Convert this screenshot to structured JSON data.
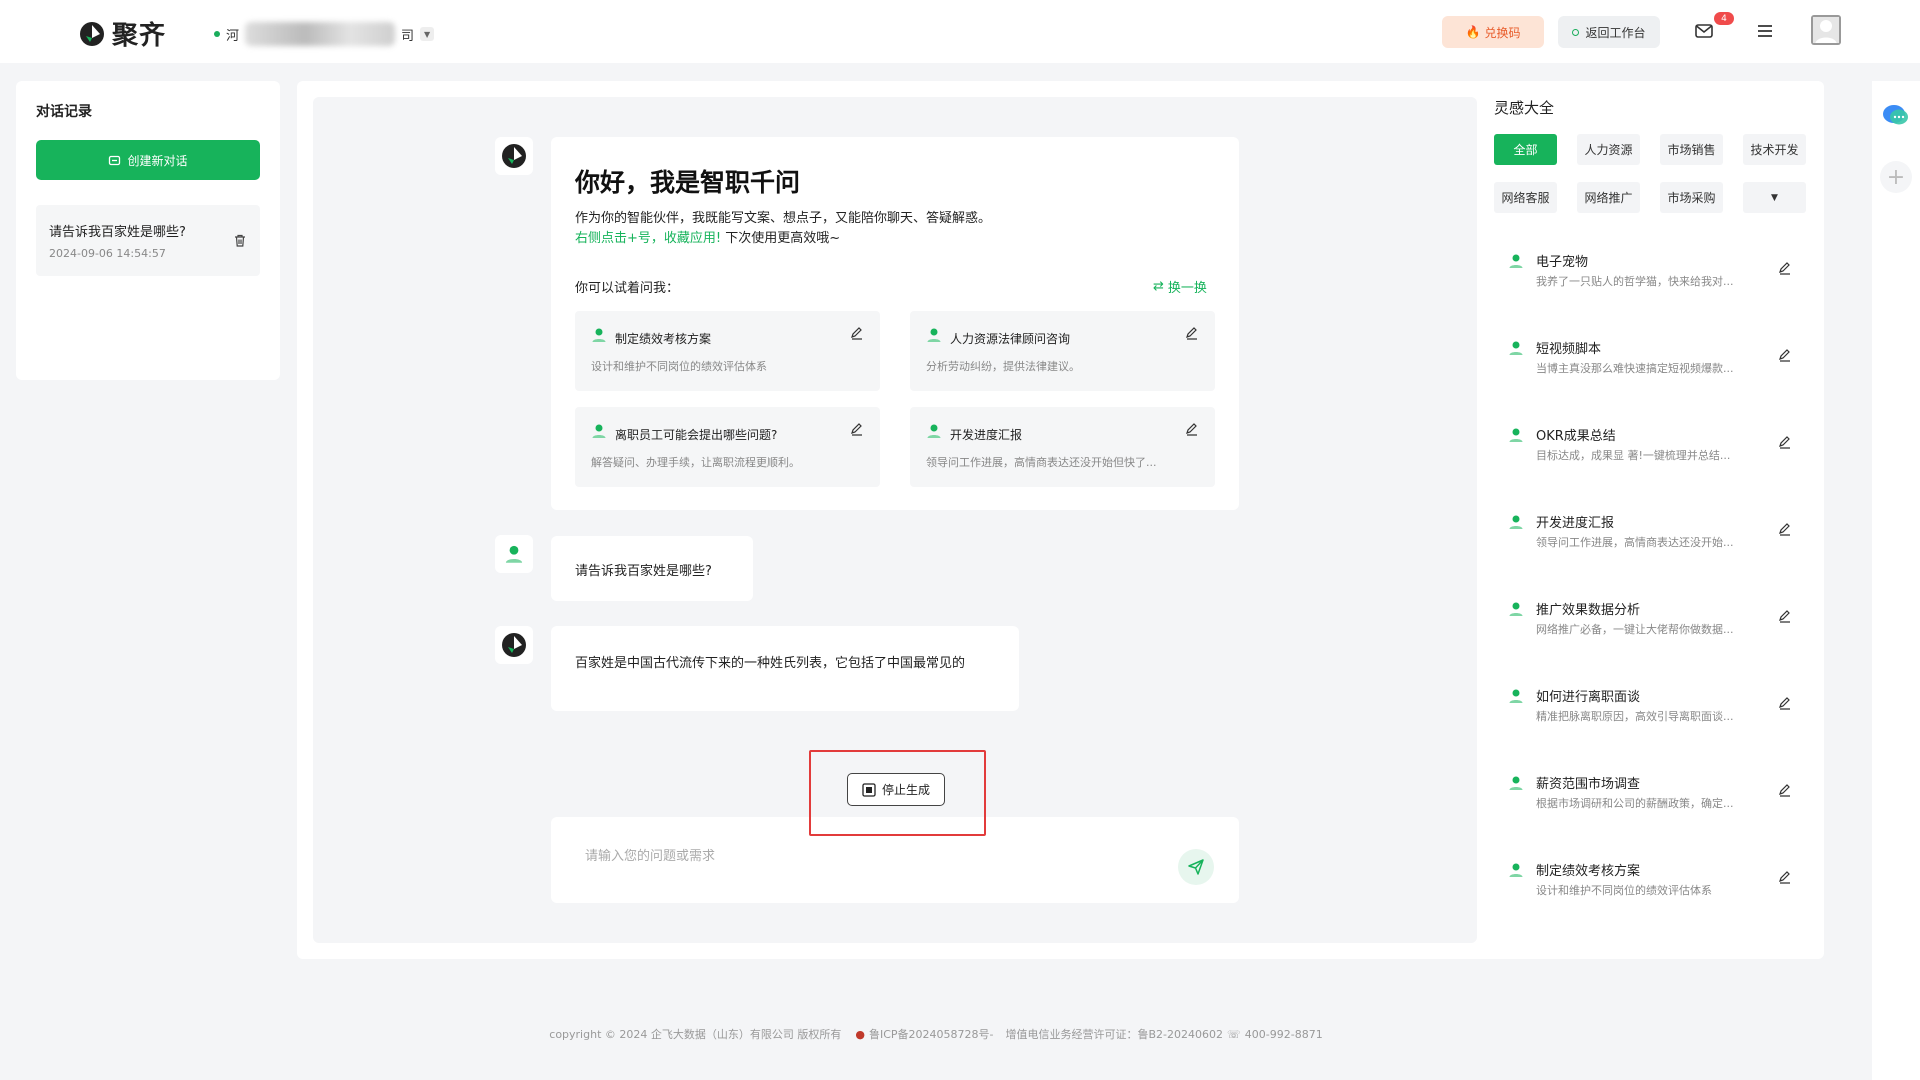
{
  "header": {
    "logo_text": "聚齐",
    "org_prefix": "河",
    "org_suffix": "司",
    "redeem_label": "兑换码",
    "back_label": "返回工作台",
    "mail_badge": "4"
  },
  "sidebar": {
    "title": "对话记录",
    "new_chat_label": "创建新对话",
    "history": [
      {
        "question": "请告诉我百家姓是哪些?",
        "time": "2024-09-06 14:54:57"
      }
    ]
  },
  "welcome": {
    "heading": "你好，我是智职千问",
    "intro": "作为你的智能伙伴，我既能写文案、想点子，又能陪你聊天、答疑解惑。",
    "tip_green": "右侧点击+号，收藏应用!",
    "tip_rest": " 下次使用更高效哦~",
    "try_label": "你可以试着问我：",
    "swap_label": "换一换",
    "cards": [
      {
        "title": "制定绩效考核方案",
        "desc": "设计和维护不同岗位的绩效评估体系"
      },
      {
        "title": "人力资源法律顾问咨询",
        "desc": "分析劳动纠纷，提供法律建议。"
      },
      {
        "title": "离职员工可能会提出哪些问题?",
        "desc": "解答疑问、办理手续，让离职流程更顺利。"
      },
      {
        "title": "开发进度汇报",
        "desc": "领导问工作进展，高情商表达还没开始但快了..."
      }
    ]
  },
  "conversation": {
    "user_message": "请告诉我百家姓是哪些?",
    "bot_message": "百家姓是中国古代流传下来的一种姓氏列表，它包括了中国最常见的"
  },
  "stop_label": "停止生成",
  "input": {
    "placeholder": "请输入您的问题或需求",
    "value": ""
  },
  "inspiration": {
    "title": "灵感大全",
    "tags": [
      "全部",
      "人力资源",
      "市场销售",
      "技术开发",
      "网络客服",
      "网络推广",
      "市场采购"
    ],
    "items": [
      {
        "title": "电子宠物",
        "desc": "我养了一只贴人的哲学猫，快来给我对..."
      },
      {
        "title": "短视频脚本",
        "desc": "当博主真没那么难快速搞定短视频爆款..."
      },
      {
        "title": "OKR成果总结",
        "desc": "目标达成，成果显 著!一键梳理并总结..."
      },
      {
        "title": "开发进度汇报",
        "desc": "领导问工作进展，高情商表达还没开始..."
      },
      {
        "title": "推广效果数据分析",
        "desc": "网络推广必备，一键让大佬帮你做数据..."
      },
      {
        "title": "如何进行离职面谈",
        "desc": "精准把脉离职原因，高效引导离职面谈..."
      },
      {
        "title": "薪资范围市场调查",
        "desc": "根据市场调研和公司的薪酬政策，确定..."
      },
      {
        "title": "制定绩效考核方案",
        "desc": "设计和维护不同岗位的绩效评估体系"
      }
    ]
  },
  "footer": {
    "copyright": "copyright © 2024 企飞大数据（山东）有限公司 版权所有",
    "icp": "鲁ICP备2024058728号-",
    "license": "增值电信业务经营许可证：鲁B2-20240602",
    "phone": "400-992-8871"
  },
  "colors": {
    "brand": "#17b35b",
    "badge": "#f04b4b",
    "highlight": "#e23b3b"
  }
}
